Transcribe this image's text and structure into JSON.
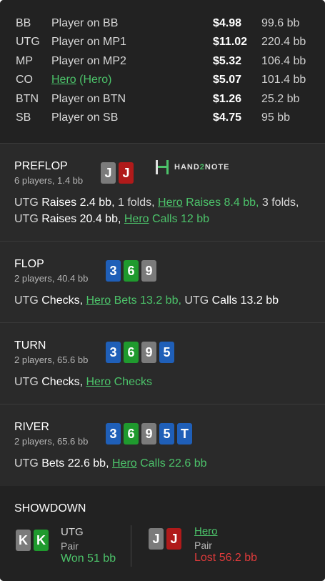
{
  "seats": [
    {
      "pos": "BB",
      "name": "Player on BB",
      "stack": "$4.98",
      "bb": "99.6 bb"
    },
    {
      "pos": "UTG",
      "name": "Player on MP1",
      "stack": "$11.02",
      "bb": "220.4 bb"
    },
    {
      "pos": "MP",
      "name": "Player on MP2",
      "stack": "$5.32",
      "bb": "106.4 bb"
    },
    {
      "pos": "CO",
      "name": "Hero",
      "tag": "(Hero)",
      "stack": "$5.07",
      "bb": "101.4 bb"
    },
    {
      "pos": "BTN",
      "name": "Player on BTN",
      "stack": "$1.26",
      "bb": "25.2 bb"
    },
    {
      "pos": "SB",
      "name": "Player on SB",
      "stack": "$4.75",
      "bb": "95 bb"
    }
  ],
  "logo": {
    "text_a": "HAND",
    "text_b": "2",
    "text_c": "NOTE"
  },
  "preflop": {
    "title": "PREFLOP",
    "sub": "6 players, 1.4 bb",
    "cards": [
      "J",
      "J"
    ],
    "line1": {
      "p1": "UTG",
      "a1": "Raises 2.4 bb,",
      "a2": "1 folds,",
      "hero": "Hero",
      "a3": "Raises 8.4 bb,",
      "a4": "3 folds,"
    },
    "line2": {
      "p1": "UTG",
      "a1": "Raises 20.4 bb,",
      "hero": "Hero",
      "a2": "Calls 12 bb"
    }
  },
  "flop": {
    "title": "FLOP",
    "sub": "2 players, 40.4 bb",
    "cards": [
      "3",
      "6",
      "9"
    ],
    "line": {
      "p1": "UTG",
      "a1": "Checks,",
      "hero": "Hero",
      "a2": "Bets 13.2 bb,",
      "p2": "UTG",
      "a3": "Calls 13.2 bb"
    }
  },
  "turn": {
    "title": "TURN",
    "sub": "2 players, 65.6 bb",
    "cards": [
      "3",
      "6",
      "9",
      "5"
    ],
    "line": {
      "p1": "UTG",
      "a1": "Checks,",
      "hero": "Hero",
      "a2": "Checks"
    }
  },
  "river": {
    "title": "RIVER",
    "sub": "2 players, 65.6 bb",
    "cards": [
      "3",
      "6",
      "9",
      "5",
      "T"
    ],
    "line": {
      "p1": "UTG",
      "a1": "Bets 22.6 bb,",
      "hero": "Hero",
      "a2": "Calls 22.6 bb"
    }
  },
  "showdown": {
    "title": "SHOWDOWN",
    "left": {
      "cards": [
        "K",
        "K"
      ],
      "name": "UTG",
      "hand": "Pair",
      "result": "Won 51 bb"
    },
    "right": {
      "cards": [
        "J",
        "J"
      ],
      "name": "Hero",
      "hand": "Pair",
      "result": "Lost 56.2 bb"
    }
  },
  "colors": {
    "win": "#4cc36a",
    "loss": "#e03b3b",
    "spade": "#7b7b7b",
    "heart": "#b01a1a",
    "diamond": "#1f5fb8",
    "club": "#1f9a2e"
  }
}
